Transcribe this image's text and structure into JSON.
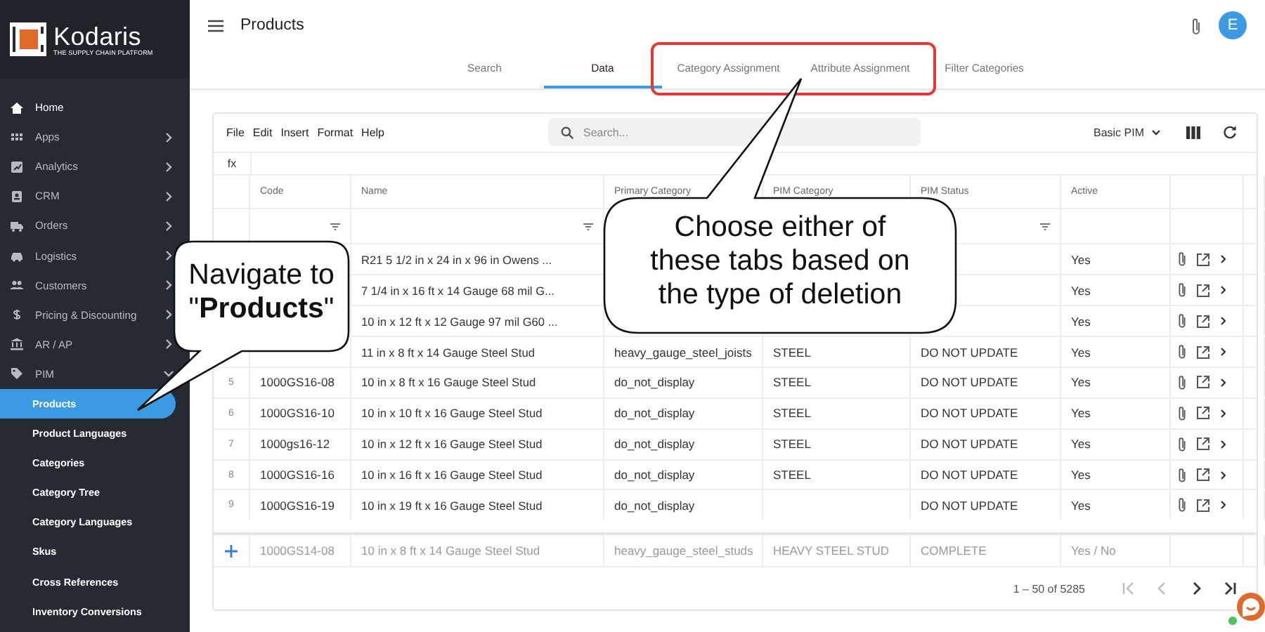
{
  "sidebar": {
    "brand": "Kodaris",
    "tagline": "THE SUPPLY CHAIN PLATFORM",
    "items": [
      {
        "label": "Home",
        "kind": "link"
      },
      {
        "label": "Apps",
        "kind": "group",
        "expanded": false
      },
      {
        "label": "Analytics",
        "kind": "group",
        "expanded": false
      },
      {
        "label": "CRM",
        "kind": "group",
        "expanded": false
      },
      {
        "label": "Orders",
        "kind": "group",
        "expanded": false
      },
      {
        "label": "Logistics",
        "kind": "group",
        "expanded": false
      },
      {
        "label": "Customers",
        "kind": "group",
        "expanded": false
      },
      {
        "label": "Pricing & Discounting",
        "kind": "group",
        "expanded": false
      },
      {
        "label": "AR / AP",
        "kind": "group",
        "expanded": false
      },
      {
        "label": "PIM",
        "kind": "group",
        "expanded": true,
        "children": [
          {
            "label": "Products",
            "selected": true
          },
          {
            "label": "Product Languages",
            "selected": false
          },
          {
            "label": "Categories",
            "selected": false
          },
          {
            "label": "Category Tree",
            "selected": false
          },
          {
            "label": "Category Languages",
            "selected": false
          },
          {
            "label": "Skus",
            "selected": false
          },
          {
            "label": "Cross References",
            "selected": false
          },
          {
            "label": "Inventory Conversions",
            "selected": false
          }
        ]
      }
    ]
  },
  "header": {
    "title": "Products",
    "avatar": "E"
  },
  "tabs": [
    {
      "label": "Search",
      "selected": false
    },
    {
      "label": "Data",
      "selected": true
    },
    {
      "label": "Category Assignment",
      "selected": false
    },
    {
      "label": "Attribute Assignment",
      "selected": false
    },
    {
      "label": "Filter Categories",
      "selected": false
    }
  ],
  "toolbar": {
    "menus": [
      "File",
      "Edit",
      "Insert",
      "Format",
      "Help"
    ],
    "search": {
      "placeholder": "Search..."
    },
    "view": "Basic PIM",
    "formula_label": "fx"
  },
  "table": {
    "columns": [
      {
        "label": "Code",
        "filter": true
      },
      {
        "label": "Name",
        "filter": true
      },
      {
        "label": "Primary Category",
        "filter": false
      },
      {
        "label": "PIM Category",
        "filter": false
      },
      {
        "label": "PIM Status",
        "filter": true
      },
      {
        "label": "Active",
        "filter": false
      }
    ],
    "rows": [
      {
        "number": null,
        "cells": [
          null,
          "R21 5 1/2 in x 24 in x 96 in Owens ...",
          null,
          null,
          null,
          "Yes"
        ]
      },
      {
        "number": null,
        "cells": [
          null,
          "7 1/4 in x 16 ft x 14 Gauge 68 mil G...",
          null,
          null,
          null,
          "Yes"
        ]
      },
      {
        "number": null,
        "cells": [
          null,
          "10 in x 12 ft x 12 Gauge 97 mil G60 ...",
          null,
          null,
          null,
          "Yes"
        ]
      },
      {
        "number": null,
        "cells": [
          null,
          "11 in x 8 ft x 14 Gauge Steel Stud",
          "heavy_gauge_steel_joists",
          "STEEL",
          "DO NOT UPDATE",
          "Yes"
        ]
      },
      {
        "number": "5",
        "cells": [
          "1000GS16-08",
          "10 in x 8 ft x 16 Gauge Steel Stud",
          "do_not_display",
          "STEEL",
          "DO NOT UPDATE",
          "Yes"
        ]
      },
      {
        "number": "6",
        "cells": [
          "1000GS16-10",
          "10 in x 10 ft x 16 Gauge Steel Stud",
          "do_not_display",
          "STEEL",
          "DO NOT UPDATE",
          "Yes"
        ]
      },
      {
        "number": "7",
        "cells": [
          "1000gs16-12",
          "10 in x 12 ft x 16 Gauge Steel Stud",
          "do_not_display",
          "STEEL",
          "DO NOT UPDATE",
          "Yes"
        ]
      },
      {
        "number": "8",
        "cells": [
          "1000GS16-16",
          "10 in x 16 ft x 16 Gauge Steel Stud",
          "do_not_display",
          "STEEL",
          "DO NOT UPDATE",
          "Yes"
        ]
      },
      {
        "number": "9",
        "cells": [
          "1000GS16-19",
          "10 in x 19 ft x 16 Gauge Steel Stud",
          "do_not_display",
          null,
          "DO NOT UPDATE",
          "Yes"
        ]
      }
    ],
    "new_row": {
      "placeholders": [
        "1000GS14-08",
        "10 in x 8 ft x 14 Gauge Steel Stud",
        "heavy_gauge_steel_studs",
        "HEAVY STEEL STUD",
        "COMPLETE",
        "Yes / No"
      ]
    }
  },
  "pagination": {
    "range": "1 – 50 of 5285",
    "buttons": [
      {
        "kind": "first",
        "disabled": true
      },
      {
        "kind": "previous",
        "disabled": true
      },
      {
        "kind": "next",
        "disabled": false
      },
      {
        "kind": "last",
        "disabled": false
      }
    ]
  },
  "chat": {
    "online": true
  },
  "callouts": [
    {
      "text": "Navigate to \"**Products**\""
    },
    {
      "text": "Choose either of these tabs based on the type of deletion"
    }
  ]
}
